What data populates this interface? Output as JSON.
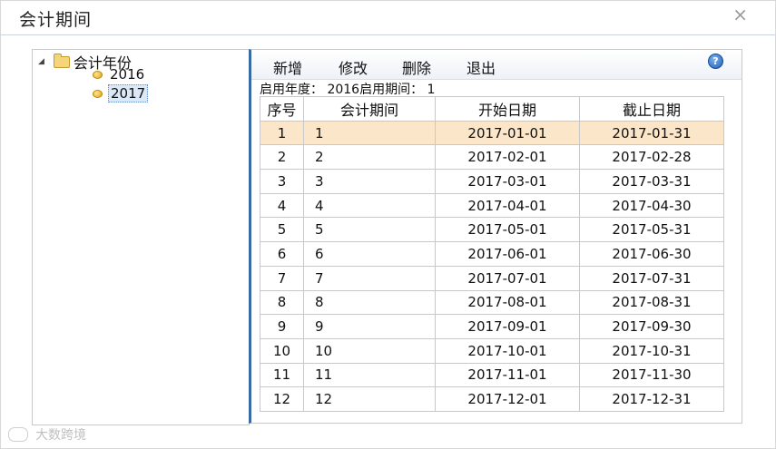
{
  "window": {
    "title": "会计期间",
    "close_glyph": "×"
  },
  "tree": {
    "root_label": "会计年份",
    "toggle_glyph": "◢",
    "items": [
      {
        "label": "2016",
        "selected": false
      },
      {
        "label": "2017",
        "selected": true
      }
    ]
  },
  "toolbar": {
    "add_label": "新增",
    "edit_label": "修改",
    "delete_label": "删除",
    "exit_label": "退出",
    "help_glyph": "?"
  },
  "info": {
    "text": "启用年度： 2016启用期间： 1"
  },
  "table": {
    "headers": [
      "序号",
      "会计期间",
      "开始日期",
      "截止日期"
    ],
    "rows": [
      [
        "1",
        "1",
        "2017-01-01",
        "2017-01-31"
      ],
      [
        "2",
        "2",
        "2017-02-01",
        "2017-02-28"
      ],
      [
        "3",
        "3",
        "2017-03-01",
        "2017-03-31"
      ],
      [
        "4",
        "4",
        "2017-04-01",
        "2017-04-30"
      ],
      [
        "5",
        "5",
        "2017-05-01",
        "2017-05-31"
      ],
      [
        "6",
        "6",
        "2017-06-01",
        "2017-06-30"
      ],
      [
        "7",
        "7",
        "2017-07-01",
        "2017-07-31"
      ],
      [
        "8",
        "8",
        "2017-08-01",
        "2017-08-31"
      ],
      [
        "9",
        "9",
        "2017-09-01",
        "2017-09-30"
      ],
      [
        "10",
        "10",
        "2017-10-01",
        "2017-10-31"
      ],
      [
        "11",
        "11",
        "2017-11-01",
        "2017-11-30"
      ],
      [
        "12",
        "12",
        "2017-12-01",
        "2017-12-31"
      ]
    ],
    "highlight_color": "#fbe6c9"
  },
  "watermark": {
    "text": "大数跨境"
  },
  "colors": {
    "accent": "#3a6aa5",
    "selected_bg": "#dbe8f7"
  }
}
